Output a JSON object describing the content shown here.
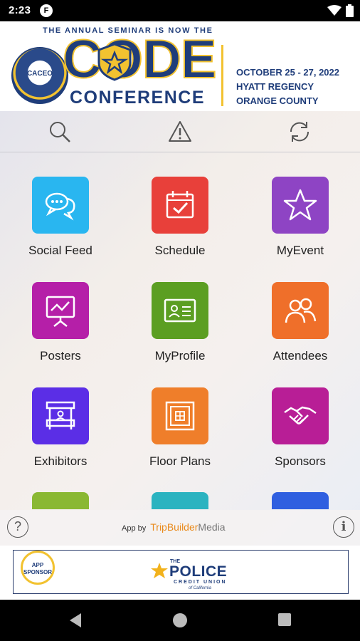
{
  "status_bar": {
    "time": "2:23",
    "notification_glyph": "F"
  },
  "banner": {
    "tagline": "THE ANNUAL SEMINAR IS NOW THE",
    "seal_text": "CACEO",
    "code_word": "CODE",
    "conference_word": "CONFERENCE",
    "dates": "OCTOBER 25 - 27, 2022",
    "venue": "HYATT REGENCY",
    "location": "ORANGE COUNTY"
  },
  "toolbar": {
    "icons": [
      "search-icon",
      "alert-icon",
      "refresh-icon"
    ]
  },
  "tiles": [
    {
      "label": "Social Feed",
      "icon": "chat-bubbles-icon",
      "color": "#29b6f0"
    },
    {
      "label": "Schedule",
      "icon": "calendar-check-icon",
      "color": "#e8403a"
    },
    {
      "label": "MyEvent",
      "icon": "star-icon",
      "color": "#8e44c4"
    },
    {
      "label": "Posters",
      "icon": "presentation-board-icon",
      "color": "#b51fa8"
    },
    {
      "label": "MyProfile",
      "icon": "id-card-icon",
      "color": "#5b9e22"
    },
    {
      "label": "Attendees",
      "icon": "people-icon",
      "color": "#ef6f2a"
    },
    {
      "label": "Exhibitors",
      "icon": "booth-icon",
      "color": "#5b2ee6"
    },
    {
      "label": "Floor Plans",
      "icon": "floor-plan-icon",
      "color": "#ef7e2a"
    },
    {
      "label": "Sponsors",
      "icon": "handshake-icon",
      "color": "#b81e96"
    }
  ],
  "partial_tiles": [
    {
      "color": "#8ab833"
    },
    {
      "color": "#2bb3c0"
    },
    {
      "color": "#2f5fe0"
    }
  ],
  "footer": {
    "help_glyph": "?",
    "info_glyph": "i",
    "app_by_prefix": "App by",
    "brand_part1": "TripBuilder",
    "brand_part2": "Media"
  },
  "sponsor": {
    "tag": "APP SPONSOR",
    "the": "THE",
    "name": "POLICE",
    "sub": "CREDIT UNION",
    "sub2": "of California"
  },
  "nav": {
    "icons": [
      "back-icon",
      "home-icon",
      "recents-icon"
    ]
  }
}
